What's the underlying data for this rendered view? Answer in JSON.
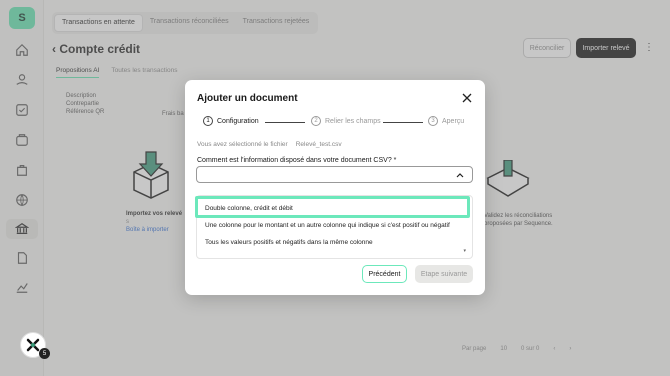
{
  "app": {
    "logo_text": "S"
  },
  "sidebar": {
    "items": [
      {
        "icon": "home-icon"
      },
      {
        "icon": "hand-coin-icon"
      },
      {
        "icon": "checklist-icon"
      },
      {
        "icon": "wallet-icon"
      },
      {
        "icon": "bag-icon"
      },
      {
        "icon": "globe-icon"
      },
      {
        "icon": "bank-icon",
        "active": true
      },
      {
        "icon": "document-icon"
      },
      {
        "icon": "chart-icon"
      }
    ]
  },
  "header": {
    "tabs": [
      "Transactions en attente",
      "Transactions réconciliées",
      "Transactions rejetées"
    ],
    "page_title": "Compte crédit",
    "reconcile_label": "Réconcilier",
    "import_label": "Importer relevé"
  },
  "subtabs": [
    "Propositions AI",
    "Toutes les transactions"
  ],
  "info_lines": [
    "Description",
    "Contrepartie",
    "Référence QR"
  ],
  "info_extra": "Frais ba",
  "left_panel": {
    "title": "Importez vos relevés",
    "text": "Importez vos relevé",
    "link": "Boîte à importer"
  },
  "right_panel": {
    "text": "Validez les réconciliations proposées par Sequence."
  },
  "pagination": {
    "per_page_label": "Par page",
    "per_page_value": "10",
    "range": "0 sur 0"
  },
  "modal": {
    "title": "Ajouter un document",
    "steps": [
      {
        "num": "1",
        "label": "Configuration"
      },
      {
        "num": "2",
        "label": "Relier les champs"
      },
      {
        "num": "3",
        "label": "Aperçu"
      }
    ],
    "file_label": "Vous avez sélectionné le fichier",
    "file_name": "Relevé_test.csv",
    "question": "Comment est l'information disposé dans votre document CSV? *",
    "options": [
      "Double colonne, crédit et débit",
      "Une colonne pour le montant et un autre colonne qui indique si c'est positif ou négatif",
      "Tous les valeurs positifs et négatifs dans la même colonne"
    ],
    "prev_label": "Précédent",
    "next_label": "Etape suivante"
  },
  "colors": {
    "accent": "#5fe3b0",
    "highlight": "#6ce8bb",
    "primary_btn": "#111111"
  }
}
